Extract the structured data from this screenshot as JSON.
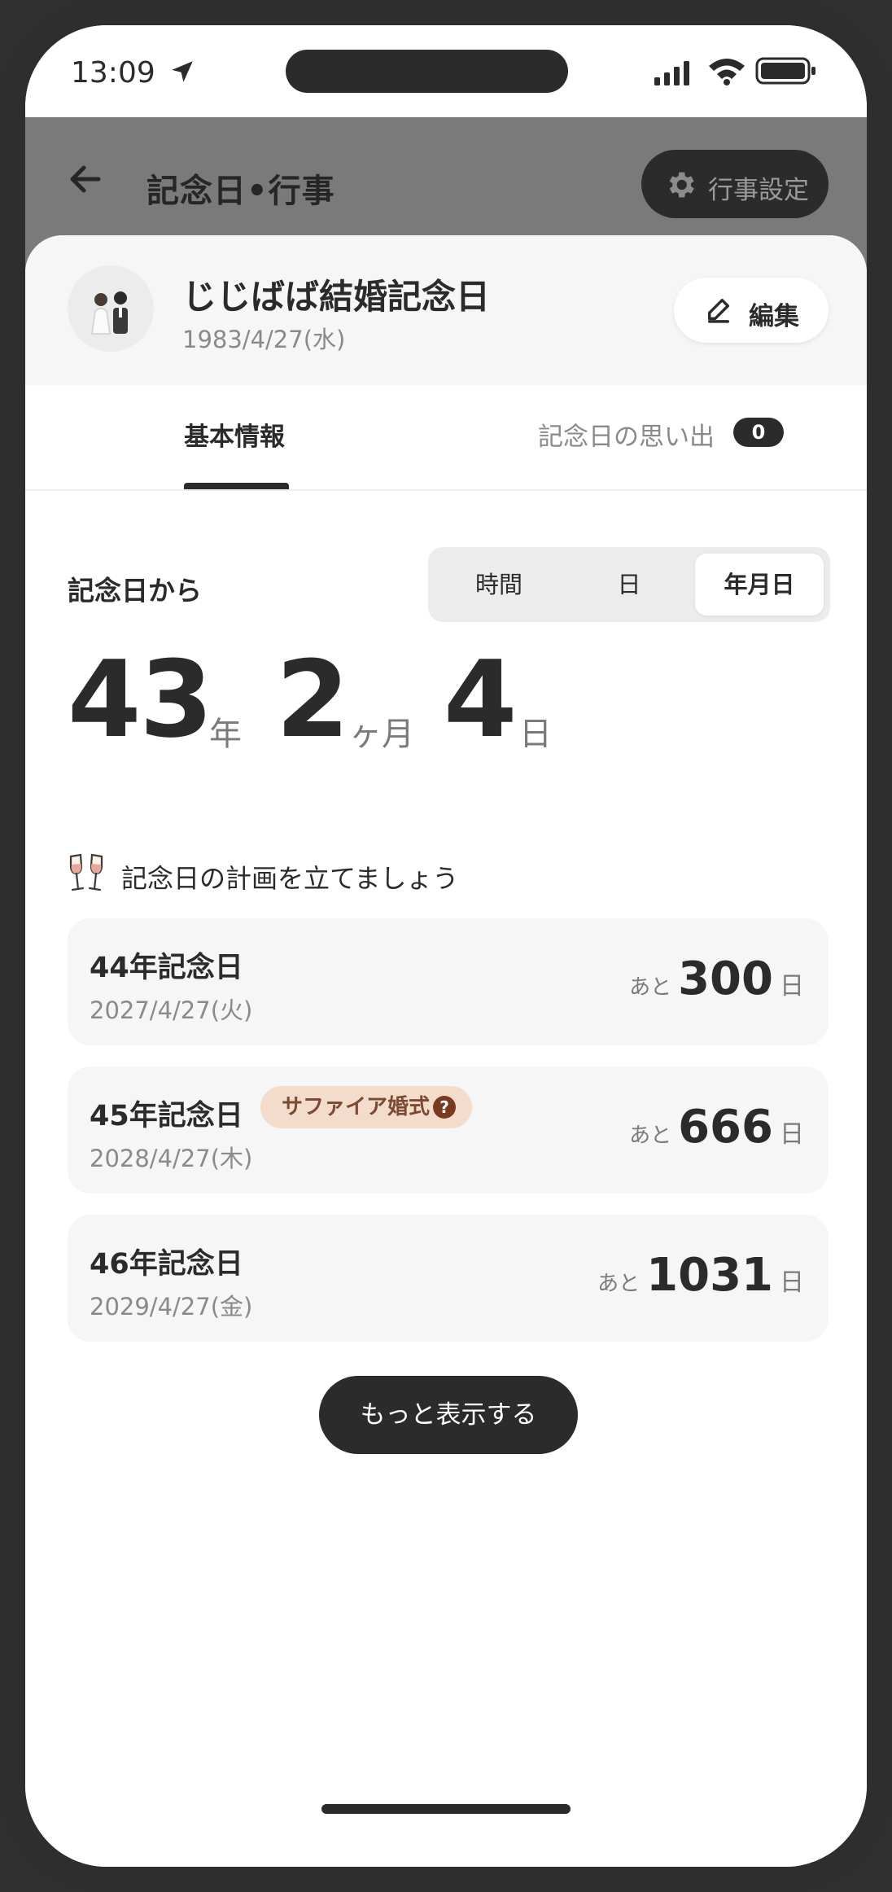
{
  "status_bar": {
    "time": "13:09"
  },
  "header": {
    "title": "記念日•行事",
    "settings_label": "行事設定"
  },
  "event": {
    "name": "じじばば結婚記念日",
    "date": "1983/4/27(水)",
    "edit_label": "編集"
  },
  "tabs": {
    "basic_label": "基本情報",
    "memories_label": "記念日の思い出",
    "memories_count": "0"
  },
  "elapsed": {
    "label": "記念日から",
    "modes": [
      "時間",
      "日",
      "年月日"
    ],
    "selected_mode": "年月日",
    "years": "43",
    "years_unit": "年",
    "months": "2",
    "months_unit": "ヶ月",
    "days": "4",
    "days_unit": "日"
  },
  "plan": {
    "heading": "記念日の計画を立てましょう",
    "remaining_prefix": "あと",
    "remaining_unit": "日",
    "items": [
      {
        "title": "44年記念日",
        "date": "2027/4/27(火)",
        "days": "300",
        "badge": ""
      },
      {
        "title": "45年記念日",
        "date": "2028/4/27(木)",
        "days": "666",
        "badge": "サファイア婚式"
      },
      {
        "title": "46年記念日",
        "date": "2029/4/27(金)",
        "days": "1031",
        "badge": ""
      }
    ]
  },
  "more_button": {
    "label": "もっと表示する"
  },
  "colors": {
    "dark": "#2b2b2b",
    "header_dim": "#7a7a7a",
    "card_bg": "#f6f6f6",
    "badge_bg": "#f4dccd",
    "badge_text": "#7a4a33"
  },
  "icons": [
    "location-arrow-icon",
    "signal-icon",
    "wifi-icon",
    "battery-icon",
    "back-arrow-icon",
    "gear-icon",
    "couple-avatar-icon",
    "pencil-icon",
    "champagne-glasses-icon",
    "help-icon"
  ]
}
